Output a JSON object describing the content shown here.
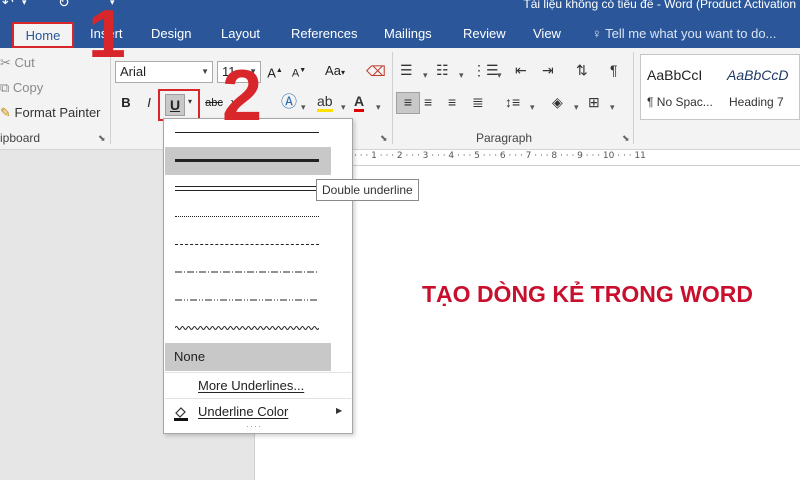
{
  "window": {
    "title": "Tài liệu không có tiêu đề - Word (Product Activation"
  },
  "tabs": [
    {
      "label": "Home"
    },
    {
      "label": "Insert"
    },
    {
      "label": "Design"
    },
    {
      "label": "Layout"
    },
    {
      "label": "References"
    },
    {
      "label": "Mailings"
    },
    {
      "label": "Review"
    },
    {
      "label": "View"
    }
  ],
  "tell_me": {
    "text": "Tell me what you want to do..."
  },
  "clipboard": {
    "cut": "Cut",
    "copy": "Copy",
    "format_painter": "Format Painter",
    "label": "ipboard"
  },
  "font": {
    "name": "Arial",
    "size": "11",
    "bold": "B",
    "italic": "I",
    "underline": "U",
    "strikethrough": "abc",
    "subscript": "x",
    "change_case": "Aa",
    "grow": "A",
    "shrink": "A"
  },
  "paragraph": {
    "label": "Paragraph"
  },
  "styles": [
    {
      "sample": "AaBbCcI",
      "name": "¶ No Spac..."
    },
    {
      "sample": "AaBbCcD",
      "name": "Heading 7"
    }
  ],
  "annotations": {
    "step1": "1",
    "step2": "2"
  },
  "ruler": {
    "text": "· · · 1 · · · 2 · · · 3 · · · 4 · · · 5 · · · 6 · · · 7 · · · 8 · · · 9 · · · 10 · · · 11"
  },
  "dropdown": {
    "none": "None",
    "more": "More Underlines...",
    "color": "Underline Color",
    "styles": [
      "single",
      "thick",
      "double",
      "dotted",
      "dashed",
      "dash-dot",
      "dash-dot-dot",
      "wave"
    ]
  },
  "tooltip": {
    "text": "Double underline"
  },
  "document": {
    "headline": "TẠO DÒNG KẺ TRONG WORD"
  },
  "colors": {
    "title_bar": "#2b579a",
    "ribbon": "#f3f3f3",
    "annotation": "#d9262b",
    "headline": "#c8102e",
    "hover": "#c8c8c8"
  },
  "icons": [
    "undo-icon",
    "redo-icon",
    "scissors-icon",
    "copy-icon",
    "paintbrush-icon",
    "clear-format-icon",
    "bullets-icon",
    "numbering-icon",
    "multilevel-icon",
    "decrease-indent-icon",
    "increase-indent-icon",
    "sort-icon",
    "pilcrow-icon",
    "text-effects-icon",
    "highlight-icon",
    "font-color-icon",
    "align-left-icon",
    "align-center-icon",
    "align-right-icon",
    "justify-icon",
    "line-spacing-icon",
    "shading-icon",
    "borders-icon",
    "lightbulb-icon",
    "underline-color-icon"
  ]
}
